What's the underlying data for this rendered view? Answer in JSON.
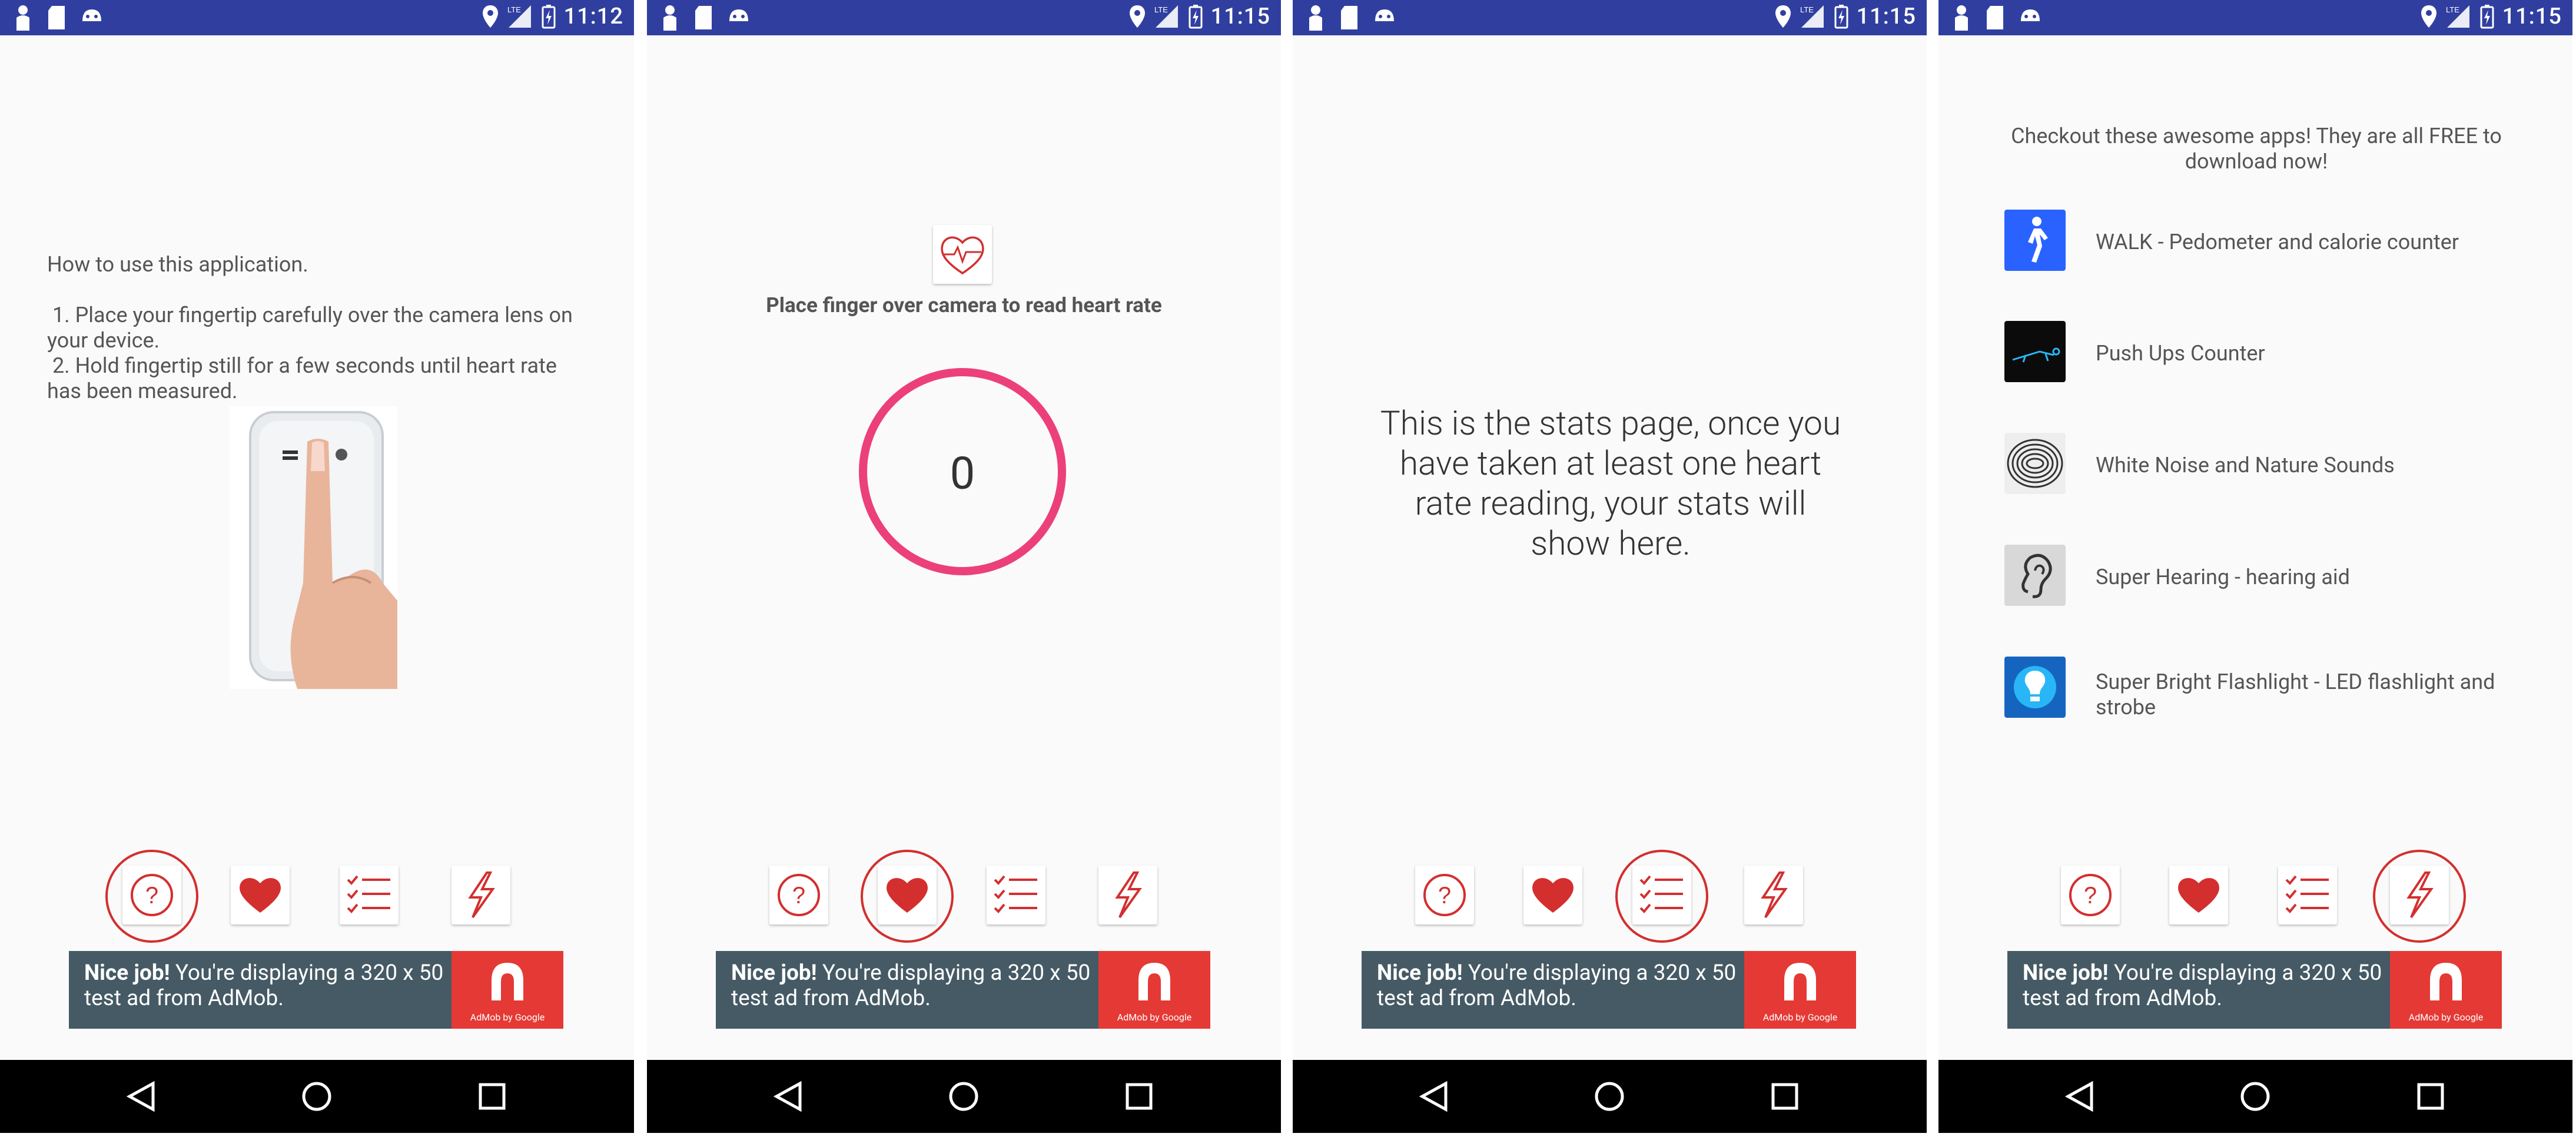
{
  "colors": {
    "statusbar": "#303f9f",
    "accent_red": "#d32f2f",
    "heart_ring": "#ec407a",
    "ad_bg": "#455a64",
    "ad_logo": "#e53935"
  },
  "screens": [
    {
      "status": {
        "time": "11:12",
        "network": "LTE"
      },
      "help": {
        "title": "How to use this application.",
        "step1": " 1. Place your fingertip carefully over the camera lens on your device.",
        "step2": " 2. Hold fingertip still for a few seconds until heart rate has been measured."
      },
      "active_tab": "help"
    },
    {
      "status": {
        "time": "11:15",
        "network": "LTE"
      },
      "measure": {
        "instruction": "Place finger over camera to read heart rate",
        "bpm": "0"
      },
      "active_tab": "heart"
    },
    {
      "status": {
        "time": "11:15",
        "network": "LTE"
      },
      "stats": {
        "message": "This is the stats page, once you have taken at least one heart rate reading, your stats will show here."
      },
      "active_tab": "stats"
    },
    {
      "status": {
        "time": "11:15",
        "network": "LTE"
      },
      "promo": {
        "title": "Checkout these awesome apps! They are all FREE to download now!",
        "apps": [
          {
            "name": "WALK - Pedometer and calorie counter",
            "icon": "walking-person-icon"
          },
          {
            "name": "Push Ups Counter",
            "icon": "pushup-icon"
          },
          {
            "name": "White Noise and Nature Sounds",
            "icon": "noise-pattern-icon"
          },
          {
            "name": "Super Hearing - hearing aid",
            "icon": "ear-icon"
          },
          {
            "name": "Super Bright Flashlight - LED flashlight and strobe",
            "icon": "lightbulb-icon"
          }
        ]
      },
      "active_tab": "flash"
    }
  ],
  "ad": {
    "bold": "Nice job!",
    "text": " You're displaying a 320 x 50 test ad from AdMob.",
    "logo_caption": "AdMob by Google"
  },
  "tabs": [
    {
      "id": "help",
      "icon": "question-mark-icon"
    },
    {
      "id": "heart",
      "icon": "heart-icon"
    },
    {
      "id": "stats",
      "icon": "checklist-icon"
    },
    {
      "id": "flash",
      "icon": "lightning-icon"
    }
  ]
}
